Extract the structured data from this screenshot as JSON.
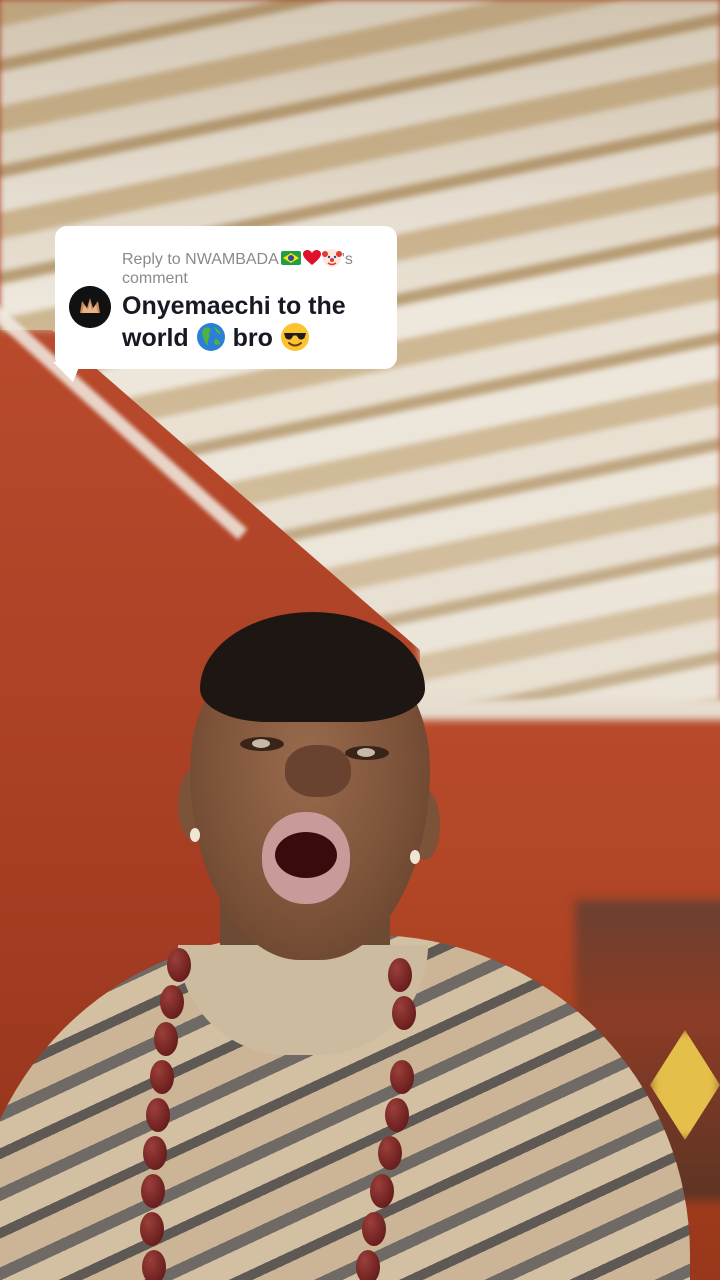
{
  "reply": {
    "prefix": "Reply to NWAMBADA",
    "suffix": "'s comment",
    "line1": "Onyemaechi to the",
    "line2_a": "world",
    "line2_b": "bro"
  },
  "icons": {
    "flag": "brazil-flag-icon",
    "heart": "red-heart-icon",
    "clown": "clown-face-icon",
    "globe": "globe-americas-icon",
    "sunglasses": "smiling-face-sunglasses-icon",
    "avatar": "crown-logo-avatar"
  },
  "colors": {
    "bubble_bg": "#ffffff",
    "reply_label": "#8a8a8a",
    "reply_text": "#161823",
    "avatar_bg": "#111111"
  }
}
